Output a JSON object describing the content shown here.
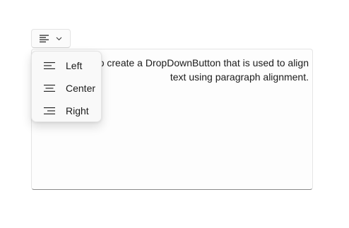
{
  "dropdown_button": {
    "icon": "align-left-icon",
    "chevron": "chevron-down-icon"
  },
  "textbox": {
    "text": "shows how to create a DropDownButton that is used to align text using paragraph alignment."
  },
  "flyout": {
    "items": [
      {
        "label": "Left",
        "icon": "align-left-icon"
      },
      {
        "label": "Center",
        "icon": "align-center-icon"
      },
      {
        "label": "Right",
        "icon": "align-right-icon"
      }
    ]
  }
}
